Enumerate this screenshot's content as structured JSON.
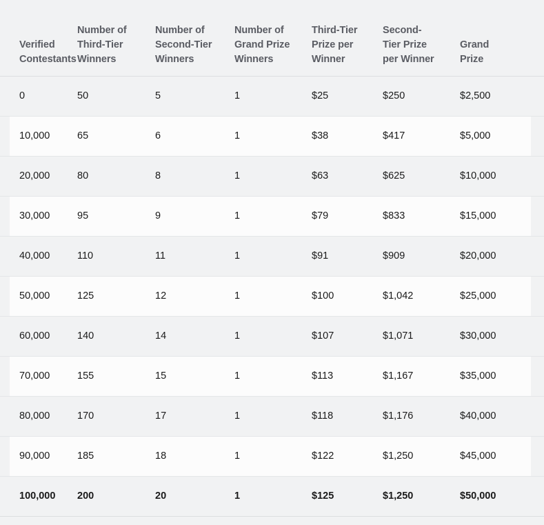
{
  "table": {
    "columns": [
      "Verified\nContestants",
      "Number of\nThird-Tier\nWinners",
      "Number of\nSecond-Tier\nWinners",
      "Number of\nGrand Prize\nWinners",
      "Third-Tier\nPrize per\nWinner",
      "Second-\nTier Prize\nper Winner",
      "Grand\nPrize"
    ],
    "rows": [
      [
        "0",
        "50",
        "5",
        "1",
        "$25",
        "$250",
        "$2,500"
      ],
      [
        "10,000",
        "65",
        "6",
        "1",
        "$38",
        "$417",
        "$5,000"
      ],
      [
        "20,000",
        "80",
        "8",
        "1",
        "$63",
        "$625",
        "$10,000"
      ],
      [
        "30,000",
        "95",
        "9",
        "1",
        "$79",
        "$833",
        "$15,000"
      ],
      [
        "40,000",
        "110",
        "11",
        "1",
        "$91",
        "$909",
        "$20,000"
      ],
      [
        "50,000",
        "125",
        "12",
        "1",
        "$100",
        "$1,042",
        "$25,000"
      ],
      [
        "60,000",
        "140",
        "14",
        "1",
        "$107",
        "$1,071",
        "$30,000"
      ],
      [
        "70,000",
        "155",
        "15",
        "1",
        "$113",
        "$1,167",
        "$35,000"
      ],
      [
        "80,000",
        "170",
        "17",
        "1",
        "$118",
        "$1,176",
        "$40,000"
      ],
      [
        "90,000",
        "185",
        "18",
        "1",
        "$122",
        "$1,250",
        "$45,000"
      ],
      [
        "100,000",
        "200",
        "20",
        "1",
        "$125",
        "$1,250",
        "$50,000"
      ]
    ],
    "total_row_index": 10,
    "colors": {
      "page_background": "#f1f2f3",
      "row_band_odd": "#f1f2f3",
      "row_band_even": "#fcfcfc",
      "header_text": "#5a5c63",
      "body_text": "#1a1a1a",
      "row_divider": "#e4e6e8"
    }
  }
}
